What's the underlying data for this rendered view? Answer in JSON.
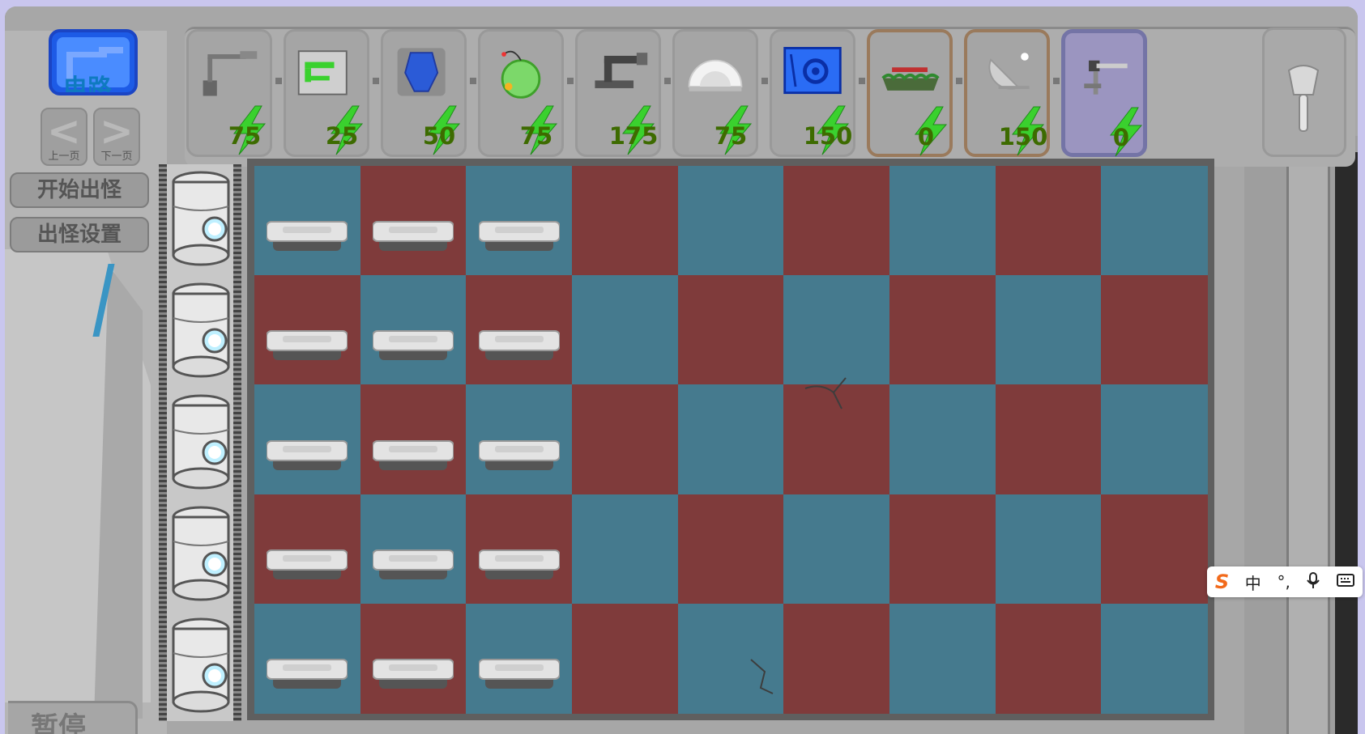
{
  "sidebar": {
    "circuit_label": "电路",
    "prev_label": "上一页",
    "next_label": "下一页",
    "start_wave_label": "开始出怪",
    "wave_settings_label": "出怪设置",
    "bottom_label": "暂停"
  },
  "seed_cards": [
    {
      "name": "robot-arm",
      "cost": "75",
      "style": "normal"
    },
    {
      "name": "green-machine",
      "cost": "25",
      "style": "normal"
    },
    {
      "name": "blue-crystal",
      "cost": "50",
      "style": "normal"
    },
    {
      "name": "green-bomb",
      "cost": "75",
      "style": "normal"
    },
    {
      "name": "crane-turret",
      "cost": "175",
      "style": "normal"
    },
    {
      "name": "dome-shield",
      "cost": "75",
      "style": "normal"
    },
    {
      "name": "gear-trap",
      "cost": "150",
      "style": "normal"
    },
    {
      "name": "grass-mine",
      "cost": "0",
      "style": "brown"
    },
    {
      "name": "satellite-dish",
      "cost": "150",
      "style": "brown"
    },
    {
      "name": "laser-gun",
      "cost": "0",
      "style": "purple"
    }
  ],
  "board": {
    "rows": 5,
    "cols": 9,
    "color_a": "#457a8e",
    "color_b": "#7f3b3b",
    "pads_columns": 3
  },
  "ime": {
    "logo": "S",
    "lang": "中",
    "punct": "°,",
    "mic_icon": "microphone-icon",
    "keyboard_icon": "keyboard-icon"
  }
}
